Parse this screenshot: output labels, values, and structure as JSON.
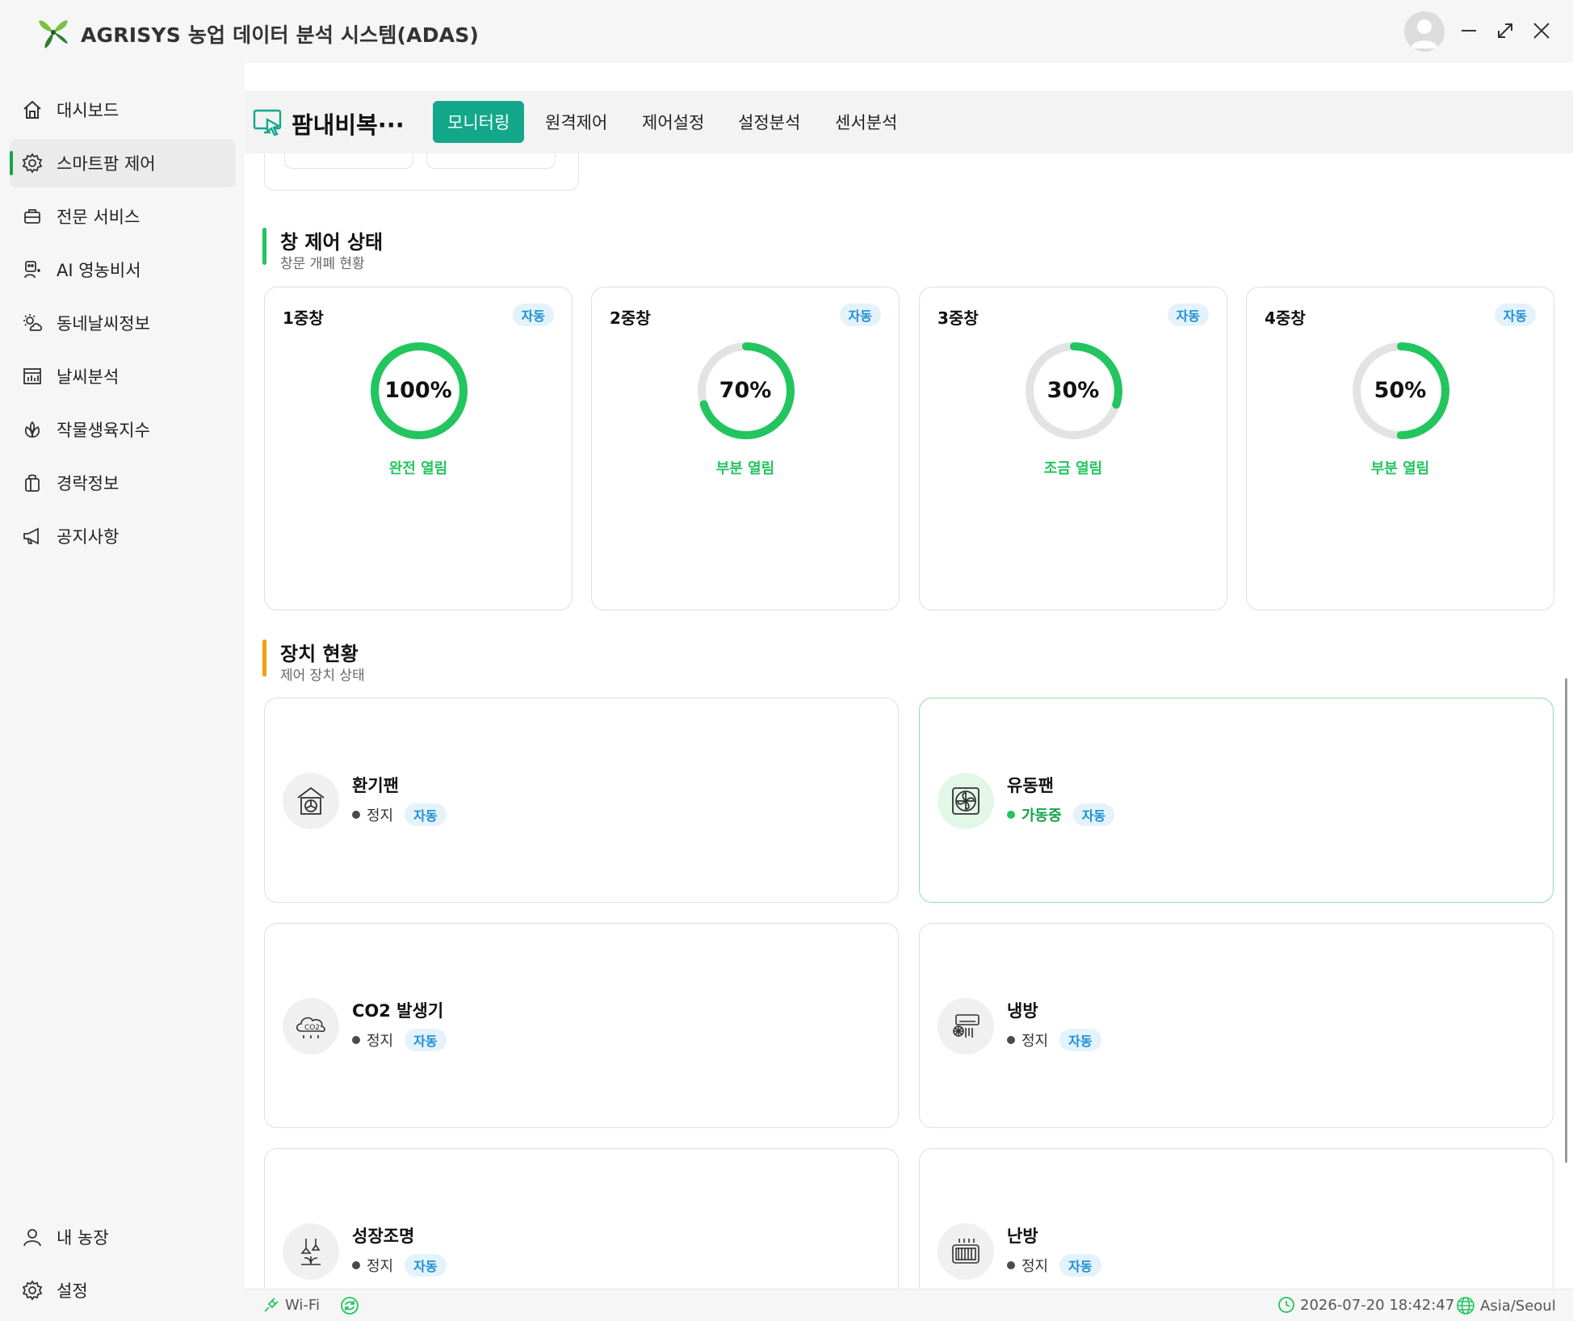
{
  "app": {
    "title": "AGRISYS 농업 데이터 분석 시스템(ADAS)"
  },
  "colors": {
    "accent": "#13a88a",
    "green": "#22c55e",
    "orange": "#f59e0b",
    "badge_bg": "#e4f3fb",
    "badge_text": "#1c8fd6"
  },
  "sidebar": {
    "items": [
      {
        "label": "대시보드",
        "icon": "home-icon",
        "active": false
      },
      {
        "label": "스마트팜 제어",
        "icon": "gear-icon",
        "active": true
      },
      {
        "label": "전문 서비스",
        "icon": "briefcase-icon",
        "active": false
      },
      {
        "label": "AI 영농비서",
        "icon": "ai-assistant-icon",
        "active": false
      },
      {
        "label": "동네날씨정보",
        "icon": "weather-icon",
        "active": false
      },
      {
        "label": "날씨분석",
        "icon": "chart-icon",
        "active": false
      },
      {
        "label": "작물생육지수",
        "icon": "plant-icon",
        "active": false
      },
      {
        "label": "경락정보",
        "icon": "bag-icon",
        "active": false
      },
      {
        "label": "공지사항",
        "icon": "megaphone-icon",
        "active": false
      }
    ],
    "bottom": [
      {
        "label": "내 농장",
        "icon": "user-icon"
      },
      {
        "label": "설정",
        "icon": "settings-icon"
      }
    ]
  },
  "header": {
    "page_title": "팜내비복···",
    "tabs": [
      {
        "label": "모니터링",
        "active": true
      },
      {
        "label": "원격제어",
        "active": false
      },
      {
        "label": "제어설정",
        "active": false
      },
      {
        "label": "설정분석",
        "active": false
      },
      {
        "label": "센서분석",
        "active": false
      }
    ]
  },
  "windows_section": {
    "title": "창 제어 상태",
    "subtitle": "창문 개폐 현황",
    "windows": [
      {
        "name": "1중창",
        "mode": "자동",
        "open_percent": 100,
        "percent_label": "100%",
        "state": "완전 열림"
      },
      {
        "name": "2중창",
        "mode": "자동",
        "open_percent": 70,
        "percent_label": "70%",
        "state": "부분 열림"
      },
      {
        "name": "3중창",
        "mode": "자동",
        "open_percent": 30,
        "percent_label": "30%",
        "state": "조금 열림"
      },
      {
        "name": "4중창",
        "mode": "자동",
        "open_percent": 50,
        "percent_label": "50%",
        "state": "부분 열림"
      }
    ]
  },
  "devices_section": {
    "title": "장치 현황",
    "subtitle": "제어 장치 상태",
    "devices": [
      {
        "name": "환기팬",
        "status": "정지",
        "mode": "자동",
        "running": false,
        "icon": "exhaust-fan-icon"
      },
      {
        "name": "유동팬",
        "status": "가동중",
        "mode": "자동",
        "running": true,
        "icon": "circulation-fan-icon"
      },
      {
        "name": "CO2 발생기",
        "status": "정지",
        "mode": "자동",
        "running": false,
        "icon": "co2-generator-icon"
      },
      {
        "name": "냉방",
        "status": "정지",
        "mode": "자동",
        "running": false,
        "icon": "air-conditioner-icon"
      },
      {
        "name": "성장조명",
        "status": "정지",
        "mode": "자동",
        "running": false,
        "icon": "grow-light-icon"
      },
      {
        "name": "난방",
        "status": "정지",
        "mode": "자동",
        "running": false,
        "icon": "heater-icon"
      }
    ]
  },
  "statusbar": {
    "network": "Wi-Fi",
    "datetime": "2026-07-20 18:42:47",
    "timezone": "Asia/Seoul"
  }
}
